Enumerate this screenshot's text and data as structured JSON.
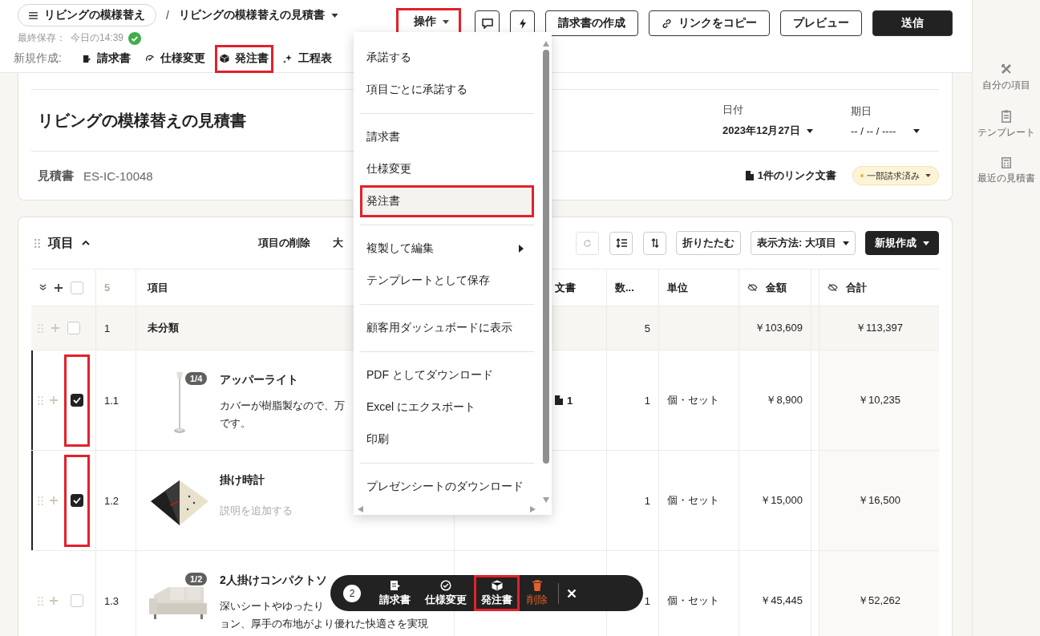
{
  "header": {
    "project": "リビングの模様替え",
    "separator": "/",
    "document_title": "リビングの模様替えの見積書",
    "saved_label": "最終保存：",
    "saved_time": "今日の14:39"
  },
  "actions": [
    {
      "kind": "dropdown",
      "label": "操作",
      "annotated": true
    },
    {
      "kind": "comment"
    },
    {
      "kind": "bolt"
    },
    {
      "kind": "outline",
      "label": "請求書の作成"
    },
    {
      "kind": "link",
      "label": "リンクをコピー"
    },
    {
      "kind": "outline",
      "label": "プレビュー"
    },
    {
      "kind": "primary",
      "label": "送信"
    }
  ],
  "new_toolbar": {
    "label": "新規作成:",
    "items": [
      {
        "label": "請求書",
        "annotated": false
      },
      {
        "label": "仕様変更",
        "annotated": false
      },
      {
        "label": "発注書",
        "annotated": true
      },
      {
        "label": "工程表",
        "annotated": false
      }
    ]
  },
  "estimate": {
    "title": "リビングの模様替えの見積書",
    "date_label": "日付",
    "date": "2023年12月27日",
    "due_label": "期日",
    "due": "-- / -- / ----",
    "doc_type": "見積書",
    "doc_number": "ES-IC-10048",
    "links": "1件のリンク文書",
    "status": "一部請求済み"
  },
  "items_section": {
    "title": "項目",
    "delete": "項目の削除",
    "cut_action": "大",
    "collapse": "折りたたむ",
    "view": "表示方法: 大項目",
    "new": "新規作成"
  },
  "table": {
    "columns": {
      "select_all_checked": false,
      "count": "5",
      "item": "項目",
      "docs": "文書",
      "qty": "数...",
      "unit": "単位",
      "amount": "金額",
      "total": "合計"
    },
    "group": {
      "checked": false,
      "number": "1",
      "name": "未分類",
      "qty": "5",
      "amount": "￥103,609",
      "total": "￥113,397"
    },
    "rows": [
      {
        "number": "1.1",
        "checked": true,
        "annotated": true,
        "badge": "1/4",
        "name": "アッパーライト",
        "lines": [
          "カバーが樹脂製なので、万",
          "です。"
        ],
        "docs": "1",
        "qty": "1",
        "unit": "個・セット",
        "amount": "￥8,900",
        "total": "￥10,235"
      },
      {
        "number": "1.2",
        "checked": true,
        "annotated": true,
        "name": "掛け時計",
        "placeholder": "説明を追加する",
        "qty": "1",
        "unit": "個・セット",
        "amount": "￥15,000",
        "total": "￥16,500"
      },
      {
        "number": "1.3",
        "checked": false,
        "annotated": false,
        "badge": "1/2",
        "name": "2人掛けコンパクトソ",
        "lines": [
          "深いシートやゆったり",
          "ョン、厚手の布地がより優れた快適さを実現"
        ],
        "qty": "1",
        "unit": "個・セット",
        "amount": "￥45,445",
        "total": "￥52,262"
      }
    ]
  },
  "menu": {
    "sections": [
      {
        "items": [
          {
            "label": "承諾する",
            "selected": false,
            "annotated": false,
            "submenu": false
          },
          {
            "label": "項目ごとに承諾する",
            "selected": false,
            "annotated": false,
            "submenu": false
          }
        ]
      },
      {
        "items": [
          {
            "label": "請求書",
            "selected": false,
            "annotated": false,
            "submenu": false
          },
          {
            "label": "仕様変更",
            "selected": false,
            "annotated": false,
            "submenu": false
          },
          {
            "label": "発注書",
            "selected": true,
            "annotated": true,
            "submenu": false
          }
        ]
      },
      {
        "items": [
          {
            "label": "複製して編集",
            "selected": false,
            "annotated": false,
            "submenu": true
          },
          {
            "label": "テンプレートとして保存",
            "selected": false,
            "annotated": false,
            "submenu": false
          }
        ]
      },
      {
        "items": [
          {
            "label": "顧客用ダッシュボードに表示",
            "selected": false,
            "annotated": false,
            "submenu": false
          }
        ]
      },
      {
        "items": [
          {
            "label": "PDF としてダウンロード",
            "selected": false,
            "annotated": false,
            "submenu": false
          },
          {
            "label": "Excel にエクスポート",
            "selected": false,
            "annotated": false,
            "submenu": false
          },
          {
            "label": "印刷",
            "selected": false,
            "annotated": false,
            "submenu": false
          }
        ]
      },
      {
        "items": [
          {
            "label": "プレゼンシートのダウンロード",
            "selected": false,
            "annotated": false,
            "submenu": false
          }
        ]
      }
    ]
  },
  "sidebar": [
    {
      "label": "自分の項目"
    },
    {
      "label": "テンプレート"
    },
    {
      "label": "最近の見積書"
    }
  ],
  "bulk_bar": {
    "count": "2",
    "actions": [
      {
        "kind": "normal",
        "label": "請求書",
        "annotated": false
      },
      {
        "kind": "normal",
        "label": "仕様変更",
        "annotated": false
      },
      {
        "kind": "normal",
        "label": "発注書",
        "annotated": true
      },
      {
        "kind": "danger",
        "label": "削除",
        "annotated": false
      }
    ]
  }
}
